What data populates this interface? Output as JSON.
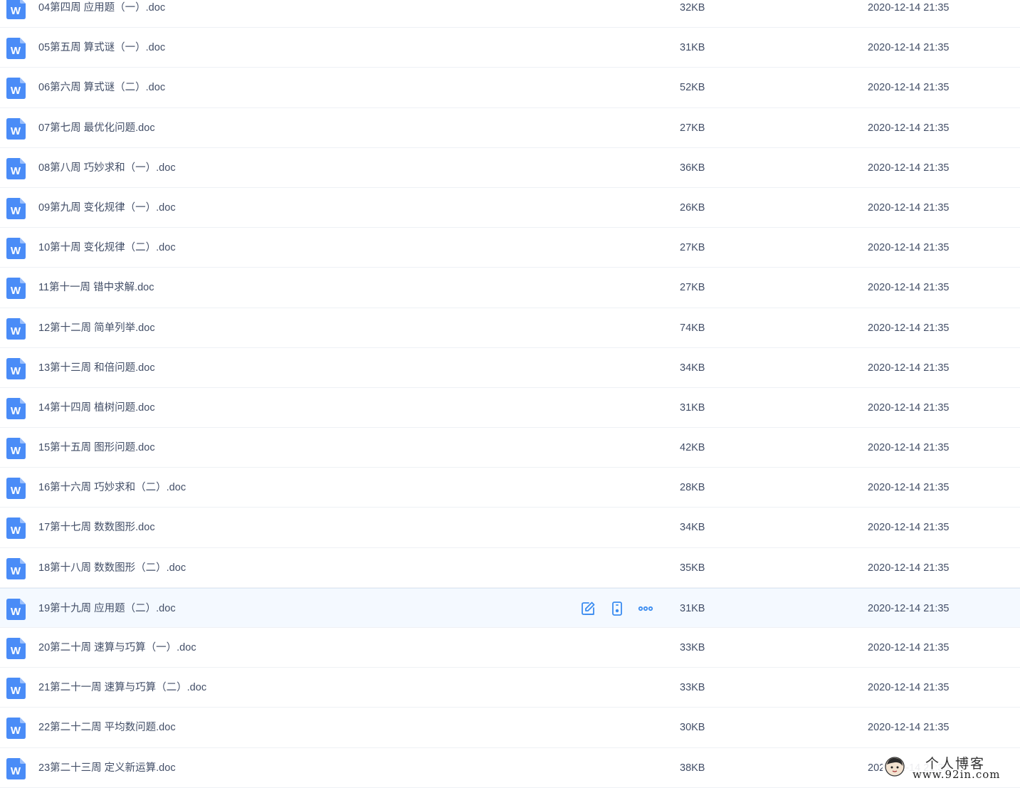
{
  "files": [
    {
      "name": "04第四周 应用题（一）.doc",
      "size": "32KB",
      "modified": "2020-12-14 21:35"
    },
    {
      "name": "05第五周 算式谜（一）.doc",
      "size": "31KB",
      "modified": "2020-12-14 21:35"
    },
    {
      "name": "06第六周 算式谜（二）.doc",
      "size": "52KB",
      "modified": "2020-12-14 21:35"
    },
    {
      "name": "07第七周 最优化问题.doc",
      "size": "27KB",
      "modified": "2020-12-14 21:35"
    },
    {
      "name": "08第八周 巧妙求和（一）.doc",
      "size": "36KB",
      "modified": "2020-12-14 21:35"
    },
    {
      "name": "09第九周 变化规律（一）.doc",
      "size": "26KB",
      "modified": "2020-12-14 21:35"
    },
    {
      "name": "10第十周 变化规律（二）.doc",
      "size": "27KB",
      "modified": "2020-12-14 21:35"
    },
    {
      "name": "11第十一周 错中求解.doc",
      "size": "27KB",
      "modified": "2020-12-14 21:35"
    },
    {
      "name": "12第十二周 简单列举.doc",
      "size": "74KB",
      "modified": "2020-12-14 21:35"
    },
    {
      "name": "13第十三周 和倍问题.doc",
      "size": "34KB",
      "modified": "2020-12-14 21:35"
    },
    {
      "name": "14第十四周 植树问题.doc",
      "size": "31KB",
      "modified": "2020-12-14 21:35"
    },
    {
      "name": "15第十五周 图形问题.doc",
      "size": "42KB",
      "modified": "2020-12-14 21:35"
    },
    {
      "name": "16第十六周 巧妙求和（二）.doc",
      "size": "28KB",
      "modified": "2020-12-14 21:35"
    },
    {
      "name": "17第十七周 数数图形.doc",
      "size": "34KB",
      "modified": "2020-12-14 21:35"
    },
    {
      "name": "18第十八周 数数图形（二）.doc",
      "size": "35KB",
      "modified": "2020-12-14 21:35"
    },
    {
      "name": "19第十九周 应用题（二）.doc",
      "size": "31KB",
      "modified": "2020-12-14 21:35",
      "hovered": true
    },
    {
      "name": "20第二十周 速算与巧算（一）.doc",
      "size": "33KB",
      "modified": "2020-12-14 21:35"
    },
    {
      "name": "21第二十一周 速算与巧算（二）.doc",
      "size": "33KB",
      "modified": "2020-12-14 21:35"
    },
    {
      "name": "22第二十二周 平均数问题.doc",
      "size": "30KB",
      "modified": "2020-12-14 21:35"
    },
    {
      "name": "23第二十三周 定义新运算.doc",
      "size": "38KB",
      "modified": "2020-12-14 21:35"
    }
  ],
  "file_icon": {
    "name": "word-doc-icon",
    "letter": "W",
    "color": "#4a8cf7"
  },
  "row_actions": {
    "icons": [
      "edit-icon",
      "phone-icon",
      "more-icon"
    ],
    "color": "#3b8cf0"
  },
  "colors": {
    "text": "#424e67",
    "row_border": "#eef1f5",
    "hover_background": "#f4f9ff"
  },
  "watermark": {
    "title": "个人博客",
    "url": "www.92in.com"
  }
}
